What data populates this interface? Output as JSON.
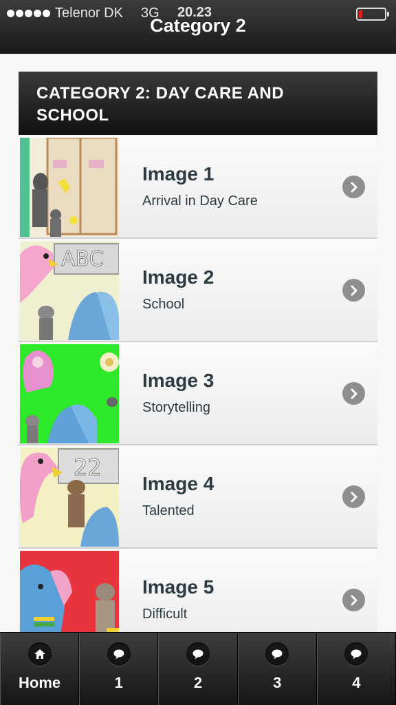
{
  "status_bar": {
    "carrier": "Telenor DK",
    "network": "3G",
    "time": "20.23"
  },
  "header": {
    "title": "Category 2"
  },
  "section": {
    "heading": "CATEGORY 2: DAY CARE AND SCHOOL"
  },
  "items": [
    {
      "title": "Image 1",
      "subtitle": "Arrival in Day Care"
    },
    {
      "title": "Image 2",
      "subtitle": "School"
    },
    {
      "title": "Image 3",
      "subtitle": "Storytelling"
    },
    {
      "title": "Image 4",
      "subtitle": "Talented"
    },
    {
      "title": "Image 5",
      "subtitle": "Difficult"
    }
  ],
  "thumb_text": {
    "abc": "ABC",
    "num": "22"
  },
  "tabs": [
    {
      "label": "Home",
      "icon": "home-icon"
    },
    {
      "label": "1",
      "icon": "speech-bubble-icon"
    },
    {
      "label": "2",
      "icon": "speech-bubble-icon"
    },
    {
      "label": "3",
      "icon": "speech-bubble-icon"
    },
    {
      "label": "4",
      "icon": "speech-bubble-icon"
    }
  ],
  "colors": {
    "battery": "#e02020",
    "title_text": "#2c3a42"
  }
}
